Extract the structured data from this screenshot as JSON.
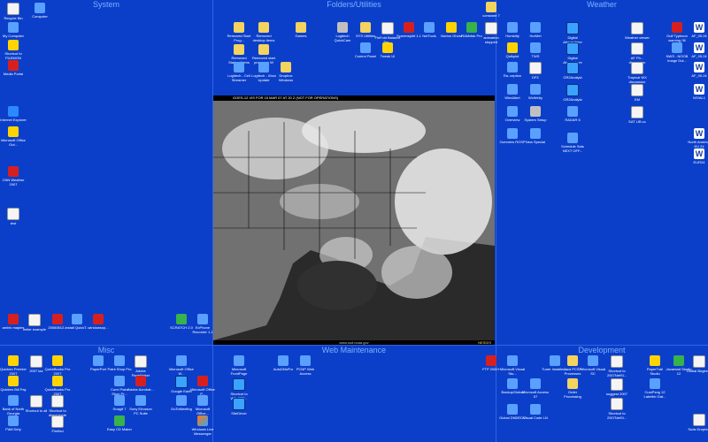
{
  "sections": {
    "system": "System",
    "folders": "Folders/Utilities",
    "weather": "Weather",
    "misc": "Misc",
    "webmaint": "Web Maintenance",
    "development": "Development"
  },
  "map": {
    "header": "GOES-12 VIS FOR 15 MAR 07 AT 20 Z (NOT FOR OPERATIONS)",
    "footer": "www.ssd.noaa.gov",
    "footer_right": "NESDIS"
  },
  "system_icons": [
    {
      "label": "Recycle Bin",
      "glyph": "recycle-bin-icon",
      "kind": "g-doc"
    },
    {
      "label": "Computer",
      "glyph": "computer-icon",
      "kind": "g-app"
    },
    {
      "label": "My Computer",
      "glyph": "my-computer-icon",
      "kind": "g-app"
    },
    {
      "label": "Shortcut to FILEMON",
      "glyph": "filemon-icon",
      "kind": "g-yellow"
    },
    {
      "label": "Media Portal",
      "glyph": "media-icon",
      "kind": "g-red"
    },
    {
      "label": "Internet Explorer",
      "glyph": "ie-icon",
      "kind": "g-ie"
    },
    {
      "label": "Microsoft Office Out...",
      "glyph": "office-icon",
      "kind": "g-yellow"
    },
    {
      "label": "CNN Weather 2007",
      "glyph": "cnn-icon",
      "kind": "g-red"
    },
    {
      "label": "test",
      "glyph": "document-icon",
      "kind": "g-doc"
    }
  ],
  "system_bottom": [
    {
      "label": "ambiv maples",
      "glyph": "pdf-icon",
      "kind": "g-red"
    },
    {
      "label": "writer example",
      "glyph": "document-icon",
      "kind": "g-doc"
    },
    {
      "label": "20060612...",
      "glyph": "pdf-icon",
      "kind": "g-red"
    },
    {
      "label": "Install QuickT...",
      "glyph": "installer-icon",
      "kind": "g-app"
    },
    {
      "label": "windowsxp...",
      "glyph": "pdf-icon",
      "kind": "g-red"
    },
    {
      "label": "SCRATCH 2.0",
      "glyph": "scratch-icon",
      "kind": "g-green"
    },
    {
      "label": "ExPhone Recorder 1.1",
      "glyph": "recorder-icon",
      "kind": "g-app"
    }
  ],
  "folder_icons": [
    {
      "label": "Removed Start Prog...",
      "glyph": "folder-icon",
      "kind": "g-folder"
    },
    {
      "label": "Removed desktop items",
      "glyph": "folder-icon",
      "kind": "g-folder"
    },
    {
      "label": "Games",
      "glyph": "folder-icon",
      "kind": "g-folder"
    },
    {
      "label": "Logitech QuickCam",
      "glyph": "webcam-icon",
      "kind": "g-gear"
    },
    {
      "label": "SYS Utilities",
      "glyph": "folder-icon",
      "kind": "g-folder"
    },
    {
      "label": "FinFold Balance Ser...",
      "glyph": "doc-icon",
      "kind": "g-doc"
    },
    {
      "label": "Screenspirit 1.1",
      "glyph": "screen-icon",
      "kind": "g-red"
    },
    {
      "label": "NetTools",
      "glyph": "net-icon",
      "kind": "g-app"
    },
    {
      "label": "Norton Ghost",
      "glyph": "ghost-icon",
      "kind": "g-yellow"
    },
    {
      "label": "RAMdisk Pro",
      "glyph": "ram-icon",
      "kind": "g-green"
    },
    {
      "label": "animation stopped",
      "glyph": "doc-icon",
      "kind": "g-doc"
    },
    {
      "label": "Control Panel",
      "glyph": "control-panel-icon",
      "kind": "g-app"
    },
    {
      "label": "Tweak UI",
      "glyph": "tweak-icon",
      "kind": "g-yellow"
    },
    {
      "label": "Removed Startup Items",
      "glyph": "folder-icon",
      "kind": "g-folder"
    },
    {
      "label": "Removed start programs W",
      "glyph": "folder-icon",
      "kind": "g-folder"
    },
    {
      "label": "Logitech - Cell Streamer",
      "glyph": "logitech-icon",
      "kind": "g-app"
    },
    {
      "label": "Logitech - Xbox Update",
      "glyph": "logitech-icon",
      "kind": "g-app"
    },
    {
      "label": "Dropbox Windows",
      "glyph": "folder-icon",
      "kind": "g-folder"
    },
    {
      "label": "comware 7",
      "glyph": "folder-icon",
      "kind": "g-folder"
    }
  ],
  "weather_icons": [
    {
      "label": "Humidity",
      "glyph": "weather-icon",
      "kind": "g-app"
    },
    {
      "label": "HurMet",
      "glyph": "hurricane-icon",
      "kind": "g-app"
    },
    {
      "label": "Digital Atmosphere",
      "glyph": "globe-icon",
      "kind": "g-globe"
    },
    {
      "label": "Weather viewer",
      "glyph": "viewer-icon",
      "kind": "g-doc"
    },
    {
      "label": "Gulf Typhoon warning 06",
      "glyph": "warning-icon",
      "kind": "g-red"
    },
    {
      "label": "AF_05.24",
      "glyph": "word-icon",
      "kind": "g-word"
    },
    {
      "label": "Quikplot",
      "glyph": "quikplot-icon",
      "kind": "g-yellow"
    },
    {
      "label": "TWS",
      "glyph": "tws-icon",
      "kind": "g-app"
    },
    {
      "label": "Digital Atmosphere",
      "glyph": "globe-icon",
      "kind": "g-globe"
    },
    {
      "label": "AF Ph... discussion",
      "glyph": "doc-icon",
      "kind": "g-doc"
    },
    {
      "label": "NWS - NOOB Image Dut...",
      "glyph": "nws-icon",
      "kind": "g-app"
    },
    {
      "label": "AF_05.24",
      "glyph": "word-icon",
      "kind": "g-word"
    },
    {
      "label": "Ra..ception",
      "glyph": "reception-icon",
      "kind": "g-app"
    },
    {
      "label": "DPZ",
      "glyph": "doc-icon",
      "kind": "g-doc"
    },
    {
      "label": "GR2Analyst",
      "glyph": "gr2-icon",
      "kind": "g-globe"
    },
    {
      "label": "Tropical WX discussion",
      "glyph": "doc-icon",
      "kind": "g-doc"
    },
    {
      "label": "AF_05.24",
      "glyph": "word-icon",
      "kind": "g-word"
    },
    {
      "label": "WindAlert",
      "glyph": "wind-icon",
      "kind": "g-app"
    },
    {
      "label": "WxWeby",
      "glyph": "web-icon",
      "kind": "g-app"
    },
    {
      "label": "GR2Analyst",
      "glyph": "gr2-icon",
      "kind": "g-globe"
    },
    {
      "label": "EM",
      "glyph": "doc-icon",
      "kind": "g-doc"
    },
    {
      "label": "WOAL1",
      "glyph": "word-icon",
      "kind": "g-word"
    },
    {
      "label": "Overview",
      "glyph": "overview-icon",
      "kind": "g-app"
    },
    {
      "label": "System Setup",
      "glyph": "setup-icon",
      "kind": "g-gear"
    },
    {
      "label": "RADAR 6",
      "glyph": "radar-icon",
      "kind": "g-app"
    },
    {
      "label": "SAT LIB.cc",
      "glyph": "doc-icon",
      "kind": "g-doc"
    },
    {
      "label": "Overview ROSP",
      "glyph": "overview-icon",
      "kind": "g-app"
    },
    {
      "label": "New Special",
      "glyph": "special-icon",
      "kind": "g-app"
    },
    {
      "label": "Schedule Sats NEXT OFF...",
      "glyph": "schedule-icon",
      "kind": "g-app"
    },
    {
      "label": "North America EU 24",
      "glyph": "word-icon",
      "kind": "g-word"
    },
    {
      "label": "EUR24",
      "glyph": "word-icon",
      "kind": "g-word"
    }
  ],
  "misc_icons": [
    {
      "label": "Quicken Premier 2007",
      "glyph": "quicken-icon",
      "kind": "g-yellow"
    },
    {
      "label": "2007 tax",
      "glyph": "doc-icon",
      "kind": "g-doc"
    },
    {
      "label": "QuickBooks Pro 2007",
      "glyph": "quickbooks-icon",
      "kind": "g-yellow"
    },
    {
      "label": "PaperPort",
      "glyph": "paperport-icon",
      "kind": "g-app"
    },
    {
      "label": "Paint Shop Pro",
      "glyph": "psp-icon",
      "kind": "g-app"
    },
    {
      "label": "Adobe PageMaker",
      "glyph": "adobe-icon",
      "kind": "g-doc"
    },
    {
      "label": "Microsoft Office W...",
      "glyph": "office-icon",
      "kind": "g-app"
    },
    {
      "label": "Quicken Bill Pay",
      "glyph": "quicken-icon",
      "kind": "g-yellow"
    },
    {
      "label": "QuickBooks Pro 2007",
      "glyph": "quickbooks-icon",
      "kind": "g-yellow"
    },
    {
      "label": "Corel Paint Shop Pr...",
      "glyph": "corel-icon",
      "kind": "g-app"
    },
    {
      "label": "Adobe Acrobat...",
      "glyph": "adobe-icon",
      "kind": "g-red"
    },
    {
      "label": "Google Earth",
      "glyph": "earth-icon",
      "kind": "g-globe"
    },
    {
      "label": "Microsoft Office P...",
      "glyph": "office-icon",
      "kind": "g-red"
    },
    {
      "label": "Bank of North Georgia",
      "glyph": "bank-icon",
      "kind": "g-app"
    },
    {
      "label": "Shortcut to direct trade",
      "glyph": "doc-icon",
      "kind": "g-doc"
    },
    {
      "label": "Shortcut to all",
      "glyph": "doc-icon",
      "kind": "g-doc"
    },
    {
      "label": "SnagIt 7",
      "glyph": "snagit-icon",
      "kind": "g-app"
    },
    {
      "label": "Sony Ericsson PC Suite",
      "glyph": "sony-icon",
      "kind": "g-app"
    },
    {
      "label": "GoToMeeting",
      "glyph": "meeting-icon",
      "kind": "g-app"
    },
    {
      "label": "Microsoft Office...",
      "glyph": "office-icon",
      "kind": "g-app"
    },
    {
      "label": "PdM Dirty",
      "glyph": "pdm-icon",
      "kind": "g-app"
    },
    {
      "label": "Firefixd",
      "glyph": "doc-icon",
      "kind": "g-doc"
    },
    {
      "label": "Easy CD Maker",
      "glyph": "cd-icon",
      "kind": "g-green"
    },
    {
      "label": "Windows Live Messenger",
      "glyph": "messenger-icon",
      "kind": "g-msn"
    }
  ],
  "webmaint_icons": [
    {
      "label": "Microsoft FrontPage",
      "glyph": "frontpage-icon",
      "kind": "g-app"
    },
    {
      "label": "AutoDNsPro",
      "glyph": "dns-icon",
      "kind": "g-app"
    },
    {
      "label": "PCNP Web Access",
      "glyph": "web-access-icon",
      "kind": "g-app"
    },
    {
      "label": "FTP 2000+",
      "glyph": "ftp-icon",
      "kind": "g-red"
    },
    {
      "label": "Shortcut to WS_FTP...",
      "glyph": "wsftp-icon",
      "kind": "g-globe"
    },
    {
      "label": "SiteDriver",
      "glyph": "sitedriver-icon",
      "kind": "g-globe"
    }
  ],
  "dev_icons": [
    {
      "label": "Microsoft Visual Stu...",
      "glyph": "vs-icon",
      "kind": "g-app"
    },
    {
      "label": "Tuner Installed...",
      "glyph": "tuner-icon",
      "kind": "g-app"
    },
    {
      "label": "Java PCSP Processes",
      "glyph": "folder-icon",
      "kind": "g-folder"
    },
    {
      "label": "Microsoft Visual SC",
      "glyph": "vs-icon",
      "kind": "g-app"
    },
    {
      "label": "Shortcut to 2007NetSi...",
      "glyph": "doc-icon",
      "kind": "g-doc"
    },
    {
      "label": "PaperTrail Studio",
      "glyph": "papertrail-icon",
      "kind": "g-yellow"
    },
    {
      "label": "Javaread Studio 12",
      "glyph": "javaread-icon",
      "kind": "g-green"
    },
    {
      "label": "Global Beginner",
      "glyph": "global-icon",
      "kind": "g-doc"
    },
    {
      "label": "BackupGlobal",
      "glyph": "backup-icon",
      "kind": "g-app"
    },
    {
      "label": "Microsoft Access 07",
      "glyph": "access-icon",
      "kind": "g-app"
    },
    {
      "label": "Order Processing",
      "glyph": "folder-icon",
      "kind": "g-folder"
    },
    {
      "label": "suggest 2007",
      "glyph": "doc-icon",
      "kind": "g-doc"
    },
    {
      "label": "CustPsng 12 Labeller Dat...",
      "glyph": "labeller-icon",
      "kind": "g-app"
    },
    {
      "label": "Global DNDEDC",
      "glyph": "global-icon",
      "kind": "g-app"
    },
    {
      "label": "Visual Code LN",
      "glyph": "code-icon",
      "kind": "g-app"
    },
    {
      "label": "Shortcut to 2007NetSi...",
      "glyph": "doc-icon",
      "kind": "g-doc"
    },
    {
      "label": "Suds Dropbox",
      "glyph": "doc-icon",
      "kind": "g-doc"
    }
  ]
}
